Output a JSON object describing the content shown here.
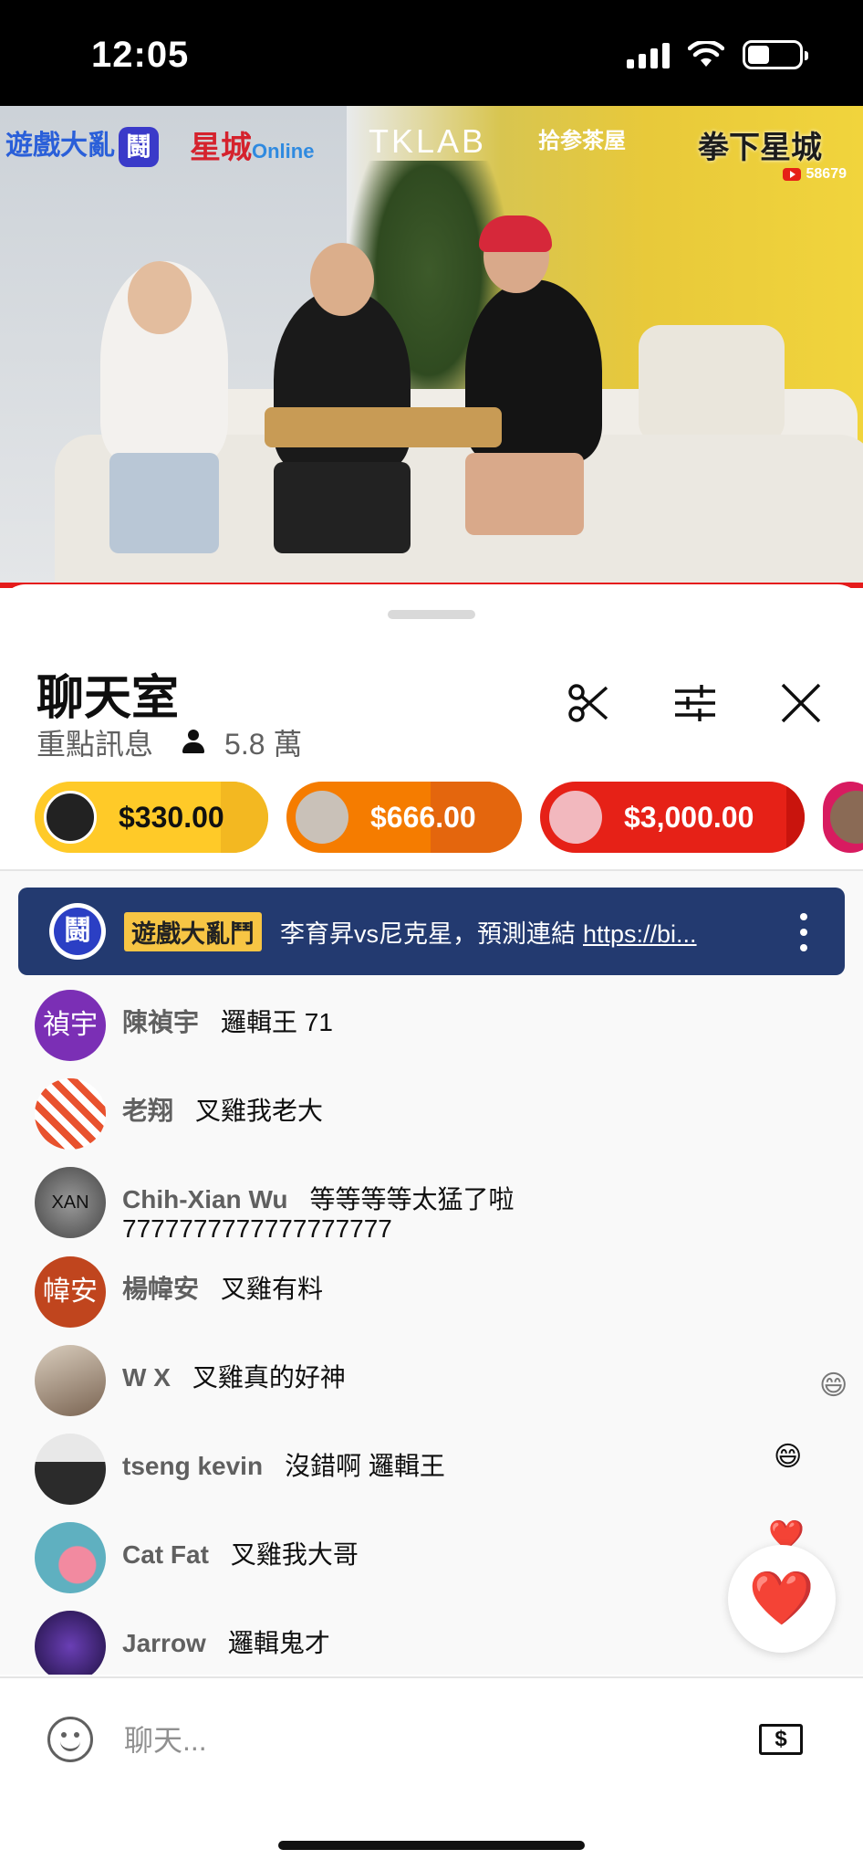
{
  "status_bar": {
    "time": "12:05"
  },
  "video": {
    "logos": [
      "遊戲大亂",
      "鬪",
      "星城",
      "Online",
      "TKLAB",
      "拾参茶屋",
      "拳下星城"
    ],
    "viewer_count": "58679"
  },
  "chat": {
    "title": "聊天室",
    "mode": "重點訊息",
    "viewers": "5.8 萬",
    "super_chats": [
      {
        "amount": "$330.00",
        "color": "#ffca28"
      },
      {
        "amount": "$666.00",
        "color": "#f57c00"
      },
      {
        "amount": "$3,000.00",
        "color": "#e62117"
      },
      {
        "amount": "",
        "color": "#d81b60"
      }
    ],
    "pinned": {
      "avatar_text": "鬪",
      "author": "遊戲大亂鬥",
      "message": "李育昇vs尼克星，預測連結",
      "link": "https://bi..."
    },
    "messages": [
      {
        "avatar_text": "禎宇",
        "avatar_color": "#7b2fb5",
        "author": "陳禎宇",
        "text": "邏輯王 71"
      },
      {
        "avatar_text": "",
        "avatar_color": "#f2f2f2",
        "author": "老翔",
        "text": "叉雞我老大"
      },
      {
        "avatar_text": "XAN",
        "avatar_color": "#555555",
        "author": "Chih-Xian Wu",
        "text": "等等等等太猛了啦 7777777777777777777"
      },
      {
        "avatar_text": "幃安",
        "avatar_color": "#c0451e",
        "author": "楊幃安",
        "text": "叉雞有料"
      },
      {
        "avatar_text": "",
        "avatar_color": "#8a7765",
        "author": "W X",
        "text": "叉雞真的好神"
      },
      {
        "avatar_text": "",
        "avatar_color": "#3b3b3b",
        "author": "tseng kevin",
        "text": "沒錯啊 邏輯王"
      },
      {
        "avatar_text": "",
        "avatar_color": "#3fa0a8",
        "author": "Cat Fat",
        "text": "叉雞我大哥"
      },
      {
        "avatar_text": "",
        "avatar_color": "#4b2a8c",
        "author": "Jarrow",
        "text": "邏輯鬼才"
      }
    ],
    "input_placeholder": "聊天...",
    "reaction_emoji": "❤️",
    "floating_emojis": [
      "😄",
      "😄",
      "❤️"
    ]
  }
}
